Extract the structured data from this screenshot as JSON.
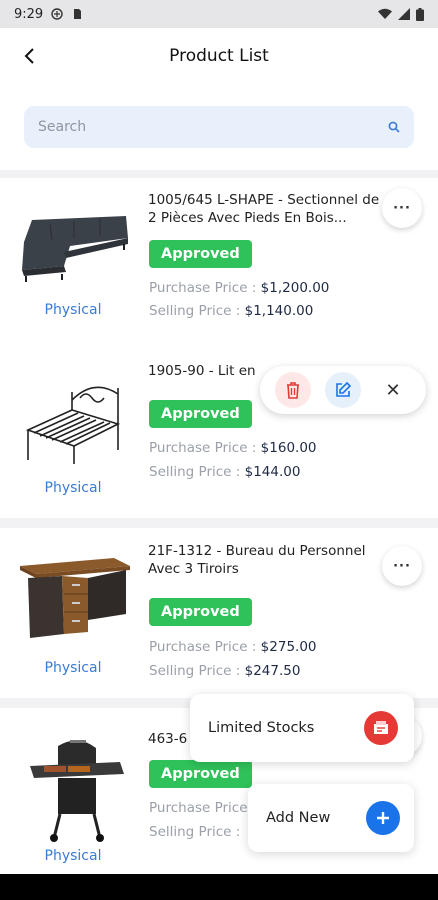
{
  "status_bar": {
    "time": "9:29"
  },
  "header": {
    "title": "Product List"
  },
  "search": {
    "placeholder": "Search"
  },
  "products": [
    {
      "name": "1005/645 L-SHAPE - Sectionnel de 2 Pièces Avec Pieds En Bois...",
      "status": "Approved",
      "purchase_label": "Purchase Price :",
      "purchase_price": "$1,200.00",
      "selling_label": "Selling Price :",
      "selling_price": "$1,140.00",
      "type": "Physical"
    },
    {
      "name": "1905-90 - Lit en",
      "status": "Approved",
      "purchase_label": "Purchase Price :",
      "purchase_price": "$160.00",
      "selling_label": "Selling Price :",
      "selling_price": "$144.00",
      "type": "Physical"
    },
    {
      "name": "21F-1312 - Bureau du Personnel Avec 3 Tiroirs",
      "status": "Approved",
      "purchase_label": "Purchase Price :",
      "purchase_price": "$275.00",
      "selling_label": "Selling Price :",
      "selling_price": "$247.50",
      "type": "Physical"
    },
    {
      "name": "463-6",
      "status": "Approved",
      "purchase_label": "Purchase Price",
      "purchase_price": "",
      "selling_label": "Selling Price :",
      "selling_price": "",
      "type": "Physical"
    }
  ],
  "fab_menu": {
    "limited_stocks": "Limited Stocks",
    "add_new": "Add New"
  },
  "colors": {
    "approved": "#2fc25a",
    "type_link": "#3a7bd5",
    "add_new": "#1a73e8",
    "delete": "#e53935"
  }
}
